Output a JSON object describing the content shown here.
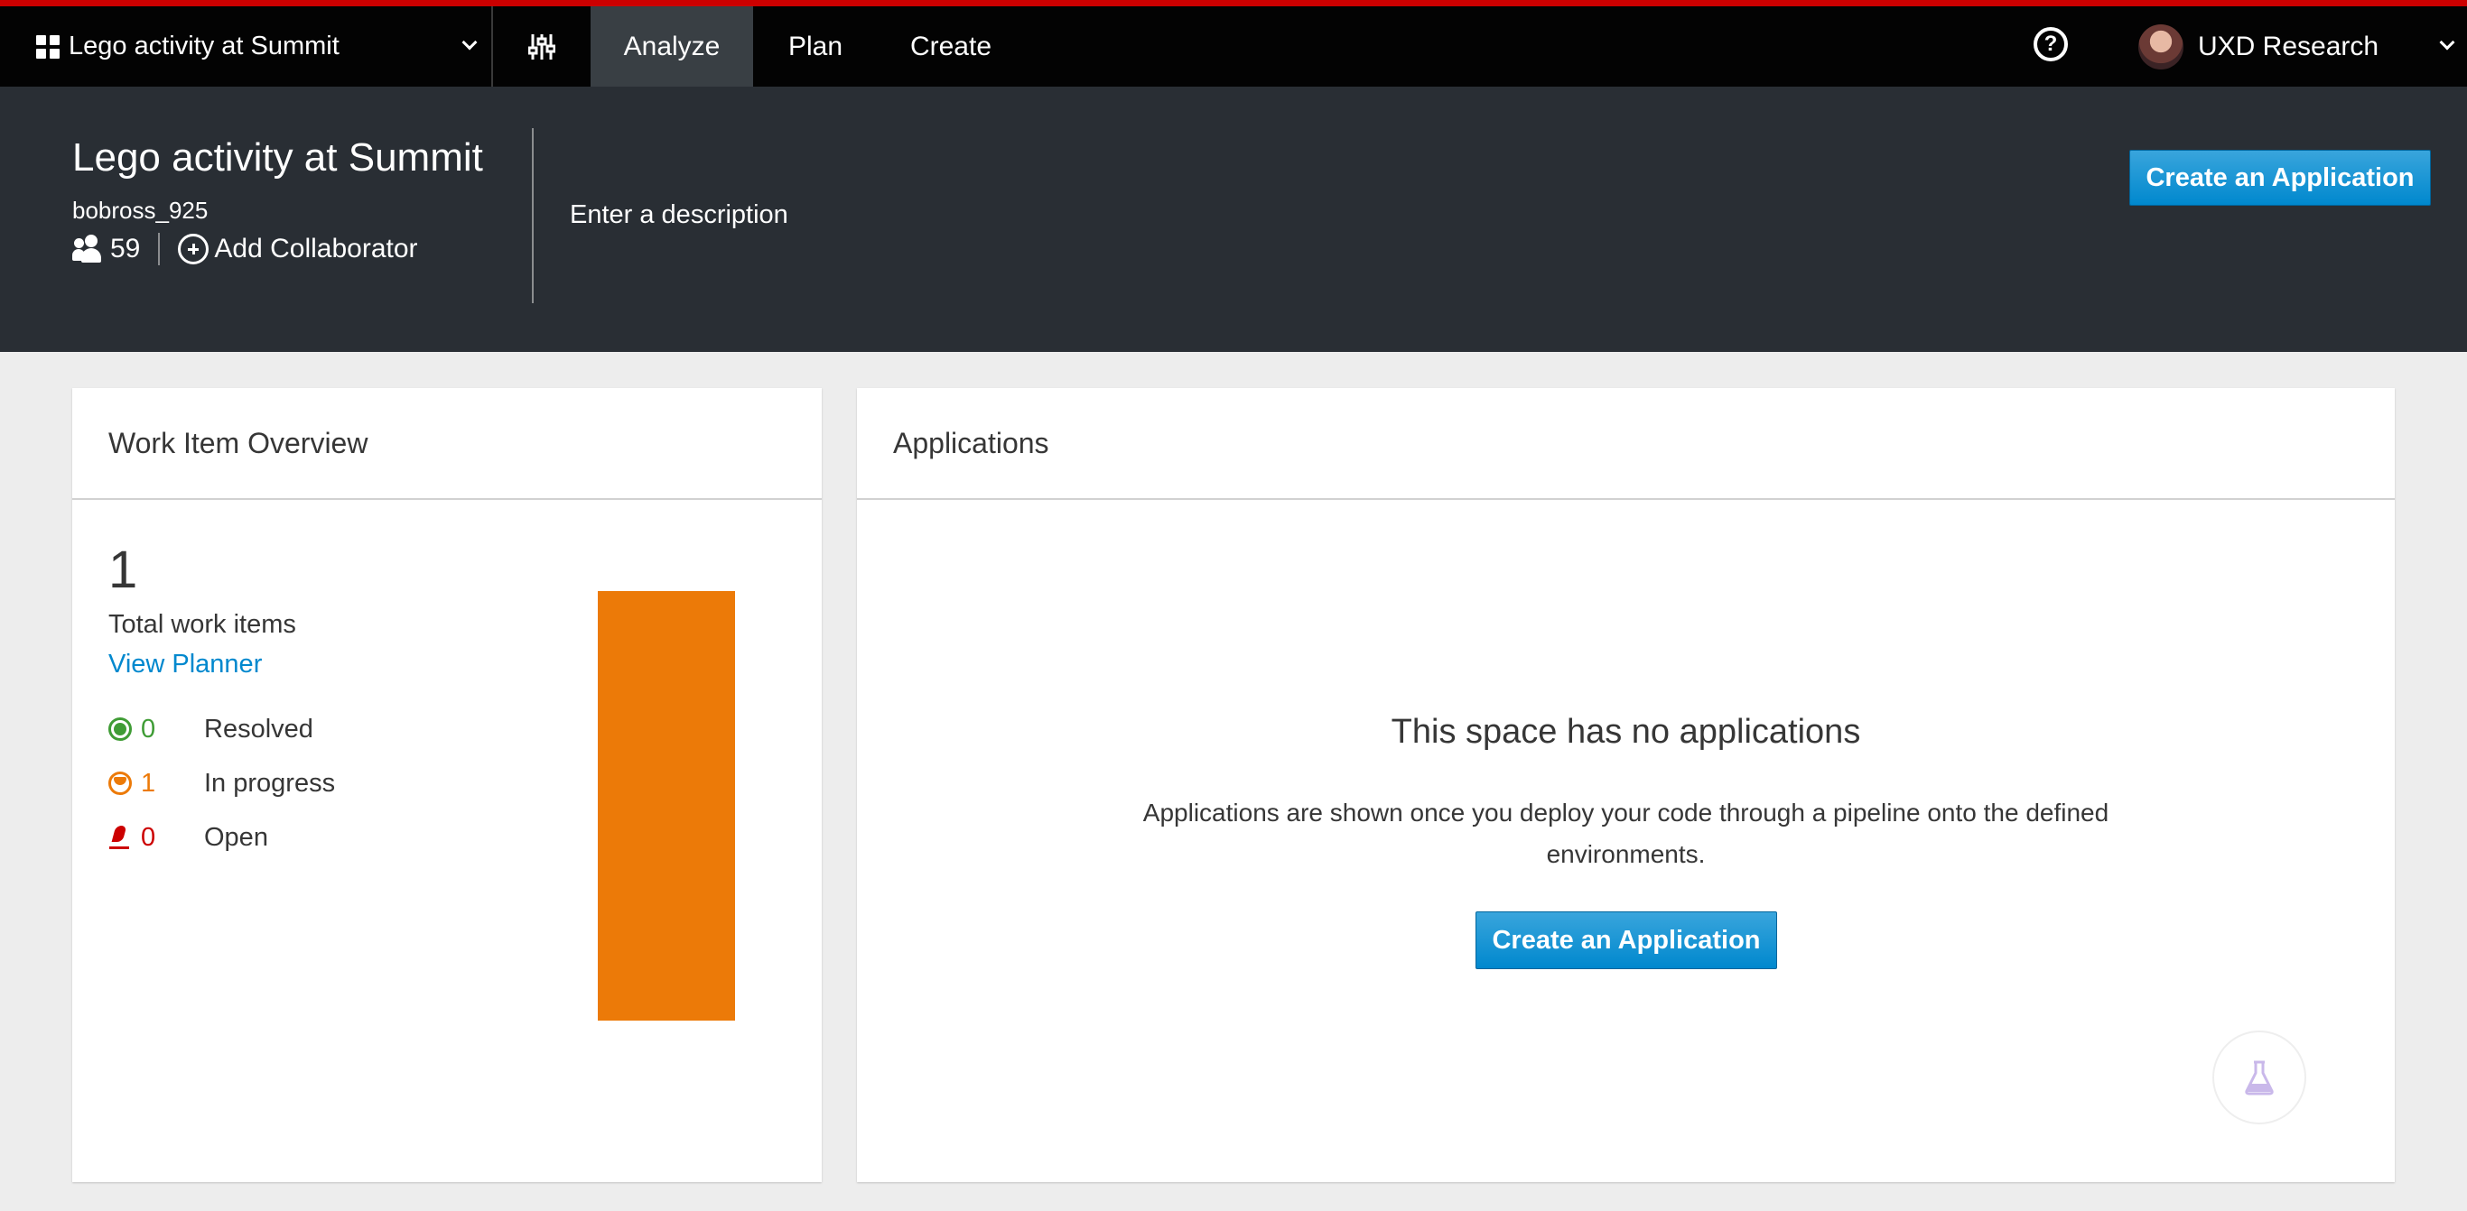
{
  "topnav": {
    "space_name": "Lego activity at Summit",
    "tabs": [
      {
        "label": "Analyze",
        "active": true
      },
      {
        "label": "Plan",
        "active": false
      },
      {
        "label": "Create",
        "active": false
      }
    ],
    "user_name": "UXD Research",
    "accent_color": "#cc0000"
  },
  "header": {
    "title": "Lego activity at Summit",
    "owner": "bobross_925",
    "member_count": "59",
    "add_collaborator_label": "Add Collaborator",
    "description_placeholder": "Enter a description",
    "create_app_label": "Create an Application"
  },
  "work_items": {
    "card_title": "Work Item Overview",
    "total": "1",
    "total_label": "Total work items",
    "view_planner_label": "View Planner",
    "stats": [
      {
        "count": "0",
        "label": "Resolved",
        "color": "#3f9c35"
      },
      {
        "count": "1",
        "label": "In progress",
        "color": "#ec7a08"
      },
      {
        "count": "0",
        "label": "Open",
        "color": "#cc0000"
      }
    ]
  },
  "applications": {
    "card_title": "Applications",
    "empty_title": "This space has no applications",
    "empty_description": "Applications are shown once you deploy your code through a pipeline onto the defined environments.",
    "create_app_label": "Create an Application"
  },
  "icons": {
    "space_switcher": "grid-icon",
    "settings": "sliders-icon",
    "help": "help-icon",
    "members": "people-icon",
    "add_collaborator": "plus-circle-icon",
    "feedback": "flask-icon"
  }
}
